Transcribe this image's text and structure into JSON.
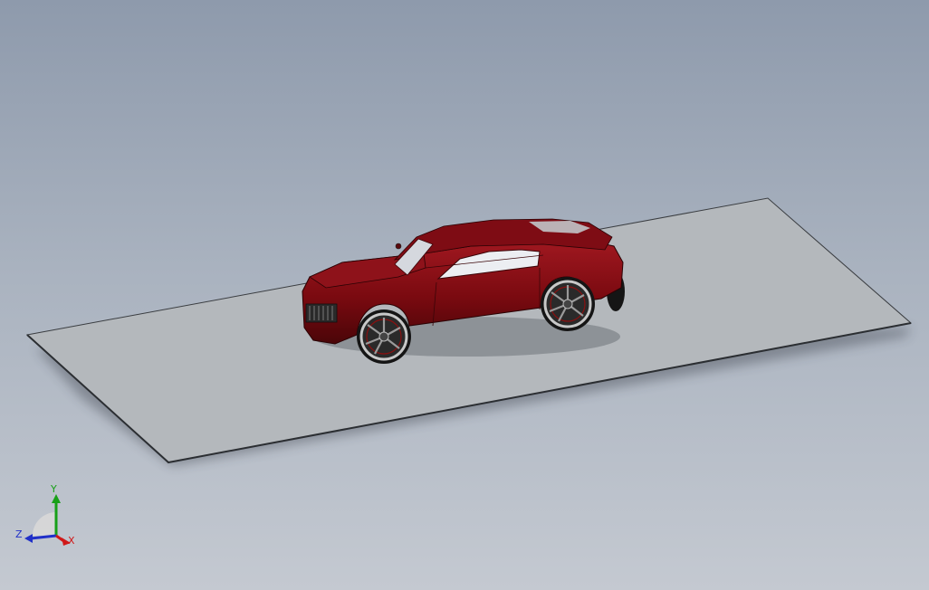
{
  "viewport": {
    "background_top": "#8e9aac",
    "background_bottom": "#c4c9d1"
  },
  "plane": {
    "fill": "#b4b8bc",
    "edge": "#3a3d41"
  },
  "car": {
    "body_color": "#7a0a10",
    "body_highlight": "#a01820",
    "glass_color": "#e6e8ec",
    "wheel_color": "#1a1a1a",
    "rim_color": "#9a9a9a"
  },
  "triad": {
    "x_label": "X",
    "y_label": "Y",
    "z_label": "Z",
    "x_color": "#d01818",
    "y_color": "#18a018",
    "z_color": "#2030c8"
  }
}
